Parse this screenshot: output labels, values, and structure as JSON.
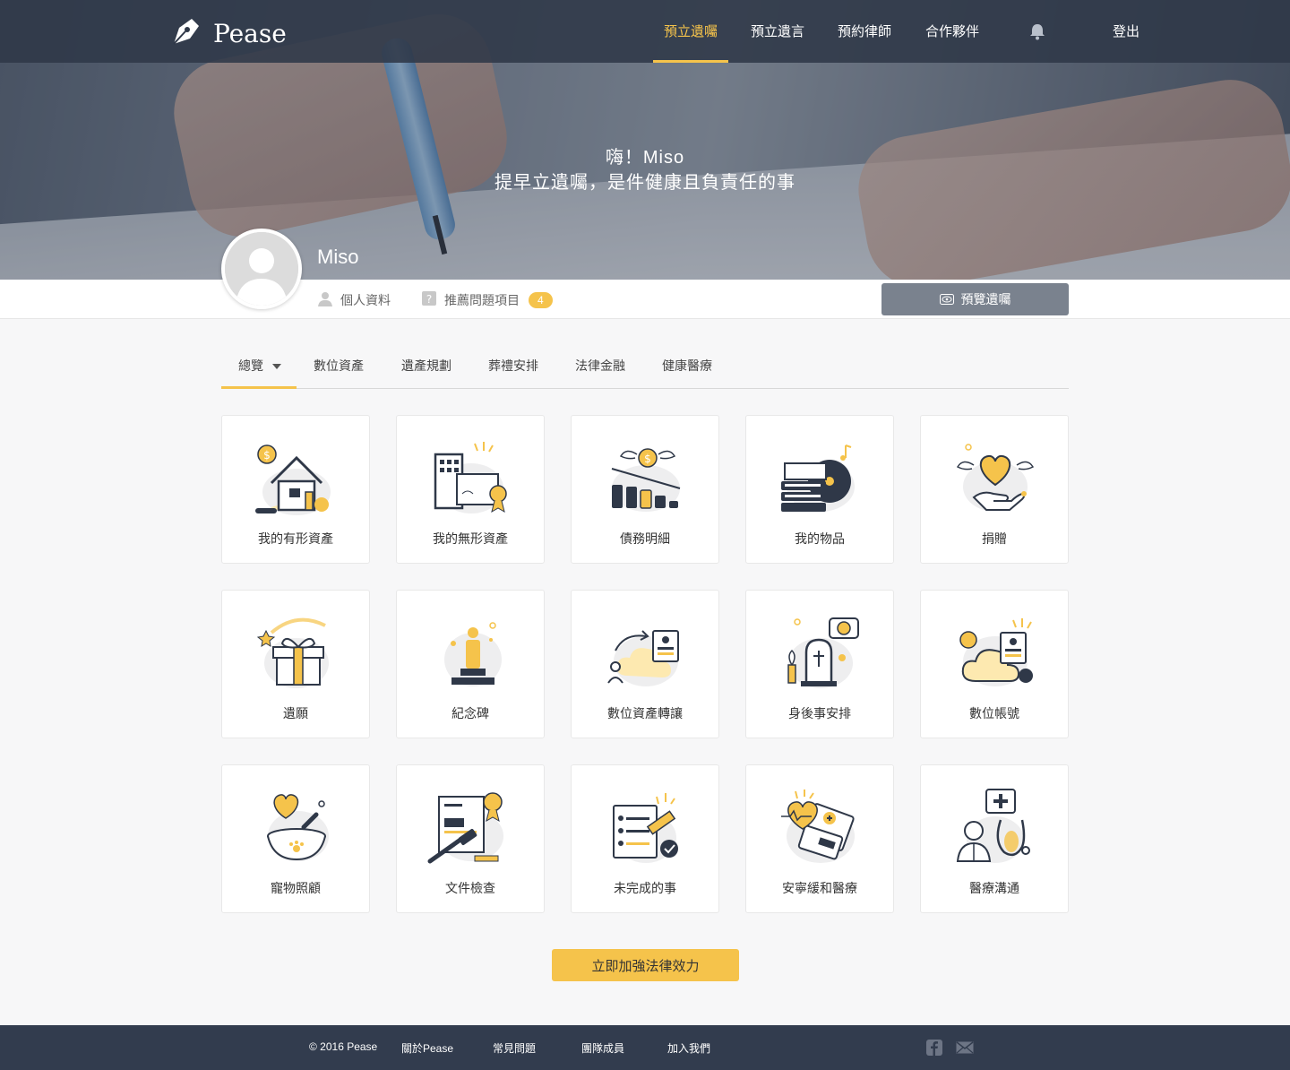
{
  "brand": {
    "name": "Pease"
  },
  "nav": {
    "items": [
      {
        "label": "預立遺囑",
        "active": true
      },
      {
        "label": "預立遺言",
        "active": false
      },
      {
        "label": "預約律師",
        "active": false
      },
      {
        "label": "合作夥伴",
        "active": false
      }
    ],
    "bell_icon": "bell-icon",
    "logout_label": "登出"
  },
  "hero": {
    "greeting": "嗨！Miso",
    "tagline": "提早立遺囑，是件健康且負責任的事"
  },
  "profile": {
    "name": "Miso",
    "personal_info_label": "個人資料",
    "recommend_label": "推薦問題項目",
    "recommend_count": "4",
    "preview_button_label": "預覽遺囑"
  },
  "tabs": [
    {
      "label": "總覽",
      "active": true
    },
    {
      "label": "數位資產"
    },
    {
      "label": "遺產規劃"
    },
    {
      "label": "葬禮安排"
    },
    {
      "label": "法律金融"
    },
    {
      "label": "健康醫療"
    }
  ],
  "cards": [
    {
      "label": "我的有形資產",
      "icon": "house-coins-icon"
    },
    {
      "label": "我的無形資產",
      "icon": "building-certificate-icon"
    },
    {
      "label": "債務明細",
      "icon": "flying-coin-bars-icon"
    },
    {
      "label": "我的物品",
      "icon": "books-record-icon"
    },
    {
      "label": "捐贈",
      "icon": "heart-hand-icon"
    },
    {
      "label": "遺願",
      "icon": "gift-box-icon"
    },
    {
      "label": "紀念碑",
      "icon": "monument-icon"
    },
    {
      "label": "數位資產轉讓",
      "icon": "cloud-transfer-icon"
    },
    {
      "label": "身後事安排",
      "icon": "tombstone-icon"
    },
    {
      "label": "數位帳號",
      "icon": "cloud-account-icon"
    },
    {
      "label": "寵物照顧",
      "icon": "pet-bowl-icon"
    },
    {
      "label": "文件檢查",
      "icon": "document-gavel-icon"
    },
    {
      "label": "未完成的事",
      "icon": "checklist-icon"
    },
    {
      "label": "安寧緩和醫療",
      "icon": "heart-medical-icon"
    },
    {
      "label": "醫療溝通",
      "icon": "doctor-stethoscope-icon"
    }
  ],
  "cta_label": "立即加強法律效力",
  "footer": {
    "copyright": "© 2016 Pease",
    "links": [
      "關於Pease",
      "常見問題",
      "團隊成員",
      "加入我們"
    ],
    "icons": [
      "facebook-icon",
      "mail-icon"
    ]
  },
  "colors": {
    "accent": "#f5c34b",
    "nav_bg": "#2f3848",
    "footer_bg": "#323c4e",
    "button_gray": "#7a828e"
  }
}
